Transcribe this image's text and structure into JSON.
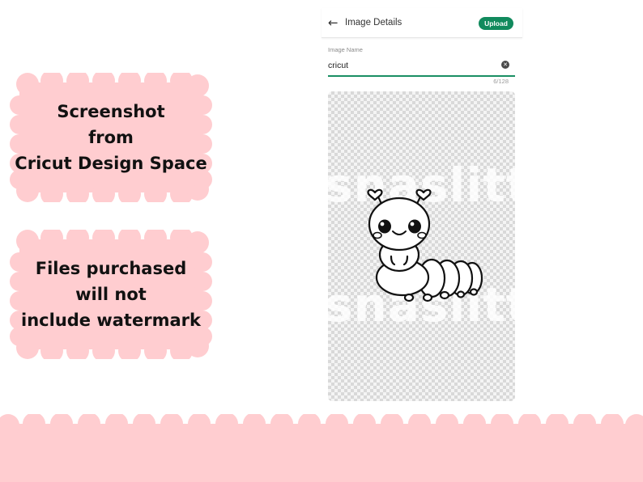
{
  "badges": [
    {
      "text": "Screenshot\nfrom\nCricut Design Space"
    },
    {
      "text": "Files purchased\nwill not\ninclude watermark"
    }
  ],
  "panel": {
    "title": "Image Details",
    "back_icon": "arrow-left-icon",
    "upload_label": "Upload",
    "field_label": "Image Name",
    "field_value": "cricut",
    "clear_icon": "clear-icon",
    "char_count": "6/128",
    "watermark_text": "snaslittl"
  },
  "colors": {
    "pink": "#ffcdd0",
    "accent_green": "#118a5d",
    "underline_green": "#1a8f63"
  }
}
